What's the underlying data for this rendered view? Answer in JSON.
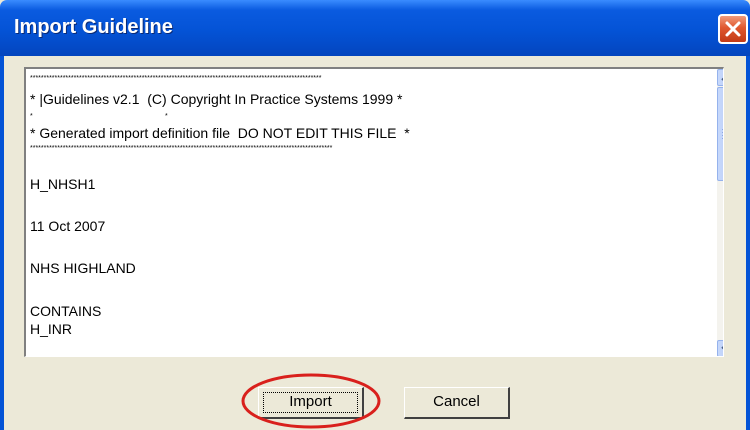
{
  "window": {
    "title": "Import Guideline",
    "close_icon": "close-icon"
  },
  "textbox": {
    "lines": [
      "***********************************************************************************************************",
      "* |Guidelines v2.1  (C) Copyright In Practice Systems 1999 *",
      "*                                                                    *",
      "* Generated import definition file  DO NOT EDIT THIS FILE  *",
      "***************************************************************************************************************",
      "H_NHSH1",
      "11 Oct 2007",
      "NHS HIGHLAND",
      "CONTAINS",
      "H_INR"
    ]
  },
  "buttons": {
    "import_label": "Import",
    "cancel_label": "Cancel"
  },
  "colors": {
    "titlebar": "#0453D6",
    "dialog_bg": "#ECE9D8",
    "highlight": "#D9201C"
  }
}
